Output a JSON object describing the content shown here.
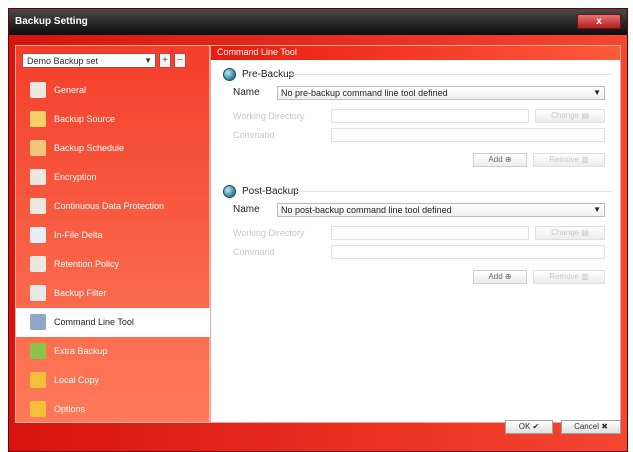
{
  "window": {
    "title": "Backup Setting",
    "close_glyph": "x"
  },
  "sidebar": {
    "backup_set": "Demo Backup set",
    "add_glyph": "+",
    "remove_glyph": "−",
    "items": [
      {
        "label": "General",
        "icon": "general-icon",
        "color": "#ece8e0"
      },
      {
        "label": "Backup Source",
        "icon": "folder-icon",
        "color": "#f4d06a"
      },
      {
        "label": "Backup Schedule",
        "icon": "schedule-icon",
        "color": "#f2c77a"
      },
      {
        "label": "Encryption",
        "icon": "encryption-icon",
        "color": "#ece8e0"
      },
      {
        "label": "Continuous Data Protection",
        "icon": "cdp-icon",
        "color": "#ece8e0"
      },
      {
        "label": "In-File Delta",
        "icon": "delta-icon",
        "color": "#e8eef8"
      },
      {
        "label": "Retention Policy",
        "icon": "retention-icon",
        "color": "#ece8e0"
      },
      {
        "label": "Backup Filter",
        "icon": "filter-icon",
        "color": "#e8e8e8"
      },
      {
        "label": "Command Line Tool",
        "icon": "command-line-icon",
        "color": "#8fa8c8"
      },
      {
        "label": "Extra Backup",
        "icon": "extra-backup-icon",
        "color": "#8cc44a"
      },
      {
        "label": "Local Copy",
        "icon": "local-copy-icon",
        "color": "#f4c03a"
      },
      {
        "label": "Options",
        "icon": "options-icon",
        "color": "#f4c03a"
      }
    ],
    "active_index": 8
  },
  "content": {
    "header": "Command Line Tool",
    "pre": {
      "title": "Pre-Backup",
      "name_label": "Name",
      "name_value": "No pre-backup command line tool defined",
      "working_dir_label": "Working Directory",
      "command_label": "Command",
      "change_label": "Change",
      "add_label": "Add",
      "remove_label": "Remove"
    },
    "post": {
      "title": "Post-Backup",
      "name_label": "Name",
      "name_value": "No post-backup command line tool defined",
      "working_dir_label": "Working Directory",
      "command_label": "Command",
      "change_label": "Change",
      "add_label": "Add",
      "remove_label": "Remove"
    }
  },
  "footer": {
    "ok_label": "OK",
    "cancel_label": "Cancel"
  }
}
